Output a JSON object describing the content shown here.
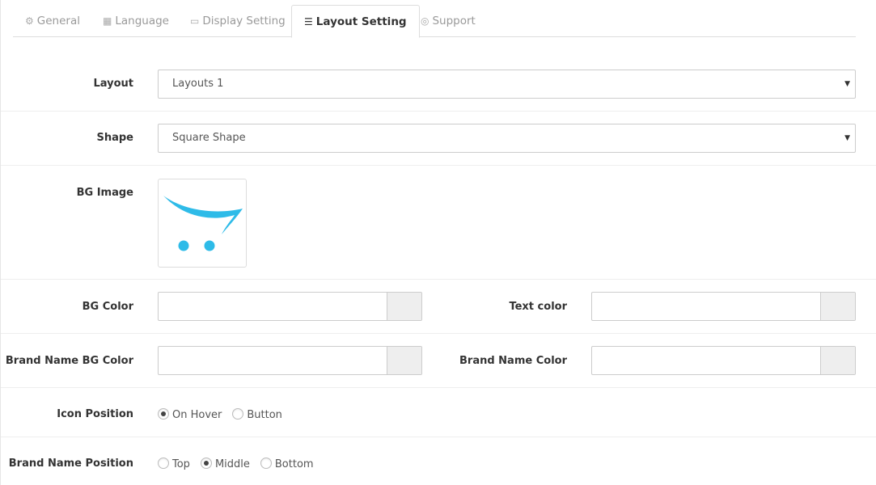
{
  "tabs": [
    {
      "label": "General",
      "icon": "gear-icon",
      "glyph": "⚙"
    },
    {
      "label": "Language",
      "icon": "book-icon",
      "glyph": "▦"
    },
    {
      "label": "Display Setting",
      "icon": "monitor-icon",
      "glyph": "▭"
    },
    {
      "label": "Layout Setting",
      "icon": "list-icon",
      "glyph": "☰",
      "active": true
    },
    {
      "label": "Support",
      "icon": "lifebuoy-icon",
      "glyph": "◎"
    }
  ],
  "form": {
    "layout": {
      "label": "Layout",
      "value": "Layouts 1"
    },
    "shape": {
      "label": "Shape",
      "value": "Square Shape"
    },
    "bg_image": {
      "label": "BG Image",
      "cart_color": "#2ebbe8"
    },
    "bg_color": {
      "label": "BG Color",
      "value": ""
    },
    "text_color": {
      "label": "Text color",
      "value": ""
    },
    "brand_bg_color": {
      "label": "Brand Name BG Color",
      "value": ""
    },
    "brand_color": {
      "label": "Brand Name Color",
      "value": ""
    },
    "icon_position": {
      "label": "Icon Position",
      "options": [
        "On Hover",
        "Button"
      ],
      "selected": "On Hover"
    },
    "brand_position": {
      "label": "Brand Name Position",
      "options": [
        "Top",
        "Middle",
        "Bottom"
      ],
      "selected": "Middle"
    }
  }
}
